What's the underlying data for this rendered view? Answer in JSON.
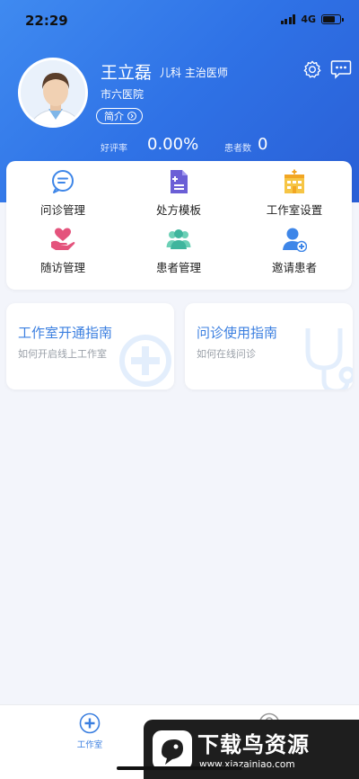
{
  "status_bar": {
    "time": "22:29",
    "network": "4G"
  },
  "profile": {
    "name": "王立磊",
    "department_title": "儿科  主治医师",
    "hospital": "市六医院",
    "intro_label": "简介",
    "rating_label": "好评率",
    "rating_value": "0.00%",
    "patients_label": "患者数",
    "patients_value": "0"
  },
  "menu": [
    {
      "label": "问诊管理",
      "icon": "chat-bubble-icon",
      "color": "#3e86e8"
    },
    {
      "label": "处方模板",
      "icon": "prescription-icon",
      "color": "#6b5fd6"
    },
    {
      "label": "工作室设置",
      "icon": "clinic-building-icon",
      "color": "#f2b431"
    },
    {
      "label": "随访管理",
      "icon": "heart-hand-icon",
      "color": "#e4537c"
    },
    {
      "label": "患者管理",
      "icon": "patients-group-icon",
      "color": "#3fb59d"
    },
    {
      "label": "邀请患者",
      "icon": "add-user-icon",
      "color": "#3e86e8"
    }
  ],
  "guides": [
    {
      "title": "工作室开通指南",
      "subtitle": "如何开启线上工作室"
    },
    {
      "title": "问诊使用指南",
      "subtitle": "如何在线问诊"
    }
  ],
  "tabbar": {
    "items": [
      {
        "label": "工作室",
        "icon": "clinic-tab-icon",
        "active": true,
        "color": "#3b7fe0"
      },
      {
        "label": "",
        "icon": "profile-tab-icon",
        "active": false,
        "color": "#999999"
      }
    ]
  },
  "watermark": {
    "main": "下载鸟资源",
    "url": "www.xiazainiao.com"
  },
  "colors": {
    "header": "#3378ea",
    "accent": "#3b7fe0",
    "background": "#f3f5fb"
  }
}
